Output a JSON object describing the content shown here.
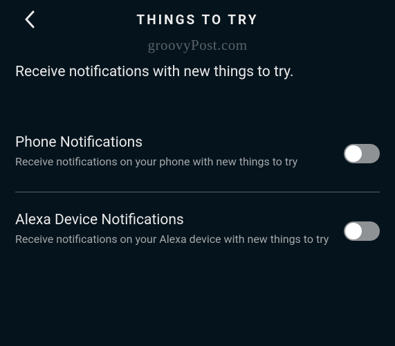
{
  "header": {
    "title": "THINGS TO TRY"
  },
  "watermark": "groovyPost.com",
  "subtitle": "Receive notifications with new things to try.",
  "settings": [
    {
      "title": "Phone Notifications",
      "description": "Receive notifications on your phone with new things to try",
      "enabled": false
    },
    {
      "title": "Alexa Device Notifications",
      "description": "Receive notifications on your Alexa device with new things to try",
      "enabled": false
    }
  ]
}
